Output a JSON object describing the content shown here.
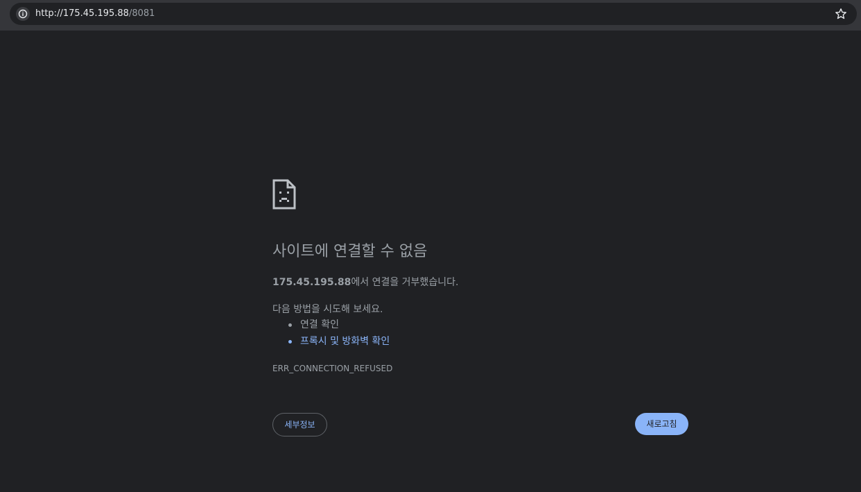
{
  "address_bar": {
    "scheme": "http://",
    "host": "175.45.195.88",
    "path": "/8081",
    "info_icon": "info-icon",
    "bookmark_icon": "star-icon"
  },
  "error_page": {
    "icon": "sad-document-icon",
    "title": "사이트에 연결할 수 없음",
    "summary_host": "175.45.195.88",
    "summary_text": "에서 연결을 거부했습니다.",
    "suggestions_heading": "다음 방법을 시도해 보세요.",
    "suggestions": [
      {
        "label": "연결 확인"
      },
      {
        "label": "프록시 및 방화벽 확인"
      }
    ],
    "error_code": "ERR_CONNECTION_REFUSED",
    "details_label": "세부정보",
    "reload_label": "새로고침"
  },
  "colors": {
    "background": "#202124",
    "toolbar": "#35363a",
    "text": "#9aa0a6",
    "link": "#8ab4f8",
    "button_primary": "#8ab4f8"
  }
}
